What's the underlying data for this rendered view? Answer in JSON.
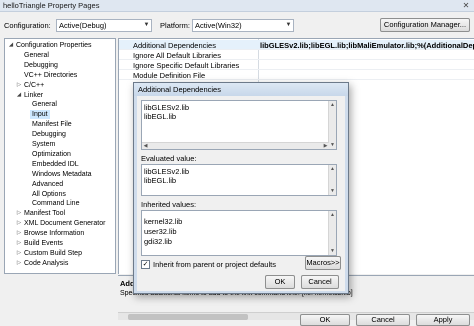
{
  "window": {
    "title": "helloTriangle Property Pages",
    "close_glyph": "✕"
  },
  "toolbar": {
    "configuration_label": "Configuration:",
    "configuration_value": "Active(Debug)",
    "platform_label": "Platform:",
    "platform_value": "Active(Win32)",
    "config_manager_label": "Configuration Manager..."
  },
  "tree": [
    {
      "label": "Configuration Properties",
      "toggle": "◢",
      "name": "tree-configuration-properties"
    },
    {
      "label": "General",
      "toggle": "",
      "name": "tree-general"
    },
    {
      "label": "Debugging",
      "toggle": "",
      "name": "tree-debugging"
    },
    {
      "label": "VC++ Directories",
      "toggle": "",
      "name": "tree-vc-directories"
    },
    {
      "label": "C/C++",
      "toggle": "▷",
      "name": "tree-c-cpp"
    },
    {
      "label": "Linker",
      "toggle": "◢",
      "name": "tree-linker"
    },
    {
      "label": "General",
      "toggle": "",
      "name": "tree-linker-general"
    },
    {
      "label": "Input",
      "toggle": "",
      "name": "tree-linker-input"
    },
    {
      "label": "Manifest File",
      "toggle": "",
      "name": "tree-linker-manifest-file"
    },
    {
      "label": "Debugging",
      "toggle": "",
      "name": "tree-linker-debugging"
    },
    {
      "label": "System",
      "toggle": "",
      "name": "tree-linker-system"
    },
    {
      "label": "Optimization",
      "toggle": "",
      "name": "tree-linker-optimization"
    },
    {
      "label": "Embedded IDL",
      "toggle": "",
      "name": "tree-linker-embedded-idl"
    },
    {
      "label": "Windows Metadata",
      "toggle": "",
      "name": "tree-linker-windows-metadata"
    },
    {
      "label": "Advanced",
      "toggle": "",
      "name": "tree-linker-advanced"
    },
    {
      "label": "All Options",
      "toggle": "",
      "name": "tree-linker-all-options"
    },
    {
      "label": "Command Line",
      "toggle": "",
      "name": "tree-linker-command-line"
    },
    {
      "label": "Manifest Tool",
      "toggle": "▷",
      "name": "tree-manifest-tool"
    },
    {
      "label": "XML Document Generator",
      "toggle": "▷",
      "name": "tree-xml-document-generator"
    },
    {
      "label": "Browse Information",
      "toggle": "▷",
      "name": "tree-browse-information"
    },
    {
      "label": "Build Events",
      "toggle": "▷",
      "name": "tree-build-events"
    },
    {
      "label": "Custom Build Step",
      "toggle": "▷",
      "name": "tree-custom-build-step"
    },
    {
      "label": "Code Analysis",
      "toggle": "▷",
      "name": "tree-code-analysis"
    }
  ],
  "properties": [
    {
      "name": "Additional Dependencies",
      "value": "libGLESv2.lib;libEGL.lib;libMaliEmulator.lib;%(AdditionalDepender"
    },
    {
      "name": "Ignore All Default Libraries",
      "value": ""
    },
    {
      "name": "Ignore Specific Default Libraries",
      "value": ""
    },
    {
      "name": "Module Definition File",
      "value": ""
    }
  ],
  "description": {
    "title": "Addi",
    "text": "Specifies additional items to add to the link command line. [i.e. kernel32.lib]"
  },
  "dialog": {
    "title": "Additional Dependencies",
    "edit_lines": [
      "libGLESv2.lib",
      "libEGL.lib"
    ],
    "evaluated_label": "Evaluated value:",
    "evaluated_lines": [
      "libGLESv2.lib",
      "libEGL.lib"
    ],
    "inherited_label": "Inherited values:",
    "inherited_lines": [
      "kernel32.lib",
      "user32.lib",
      "gdi32.lib"
    ],
    "inherit_checkbox_label": "Inherit from parent or project defaults",
    "inherit_checked": "✓",
    "macros_label": "Macros>>",
    "ok_label": "OK",
    "cancel_label": "Cancel"
  },
  "footer": {
    "ok_label": "OK",
    "cancel_label": "Cancel",
    "apply_label": "Apply"
  }
}
